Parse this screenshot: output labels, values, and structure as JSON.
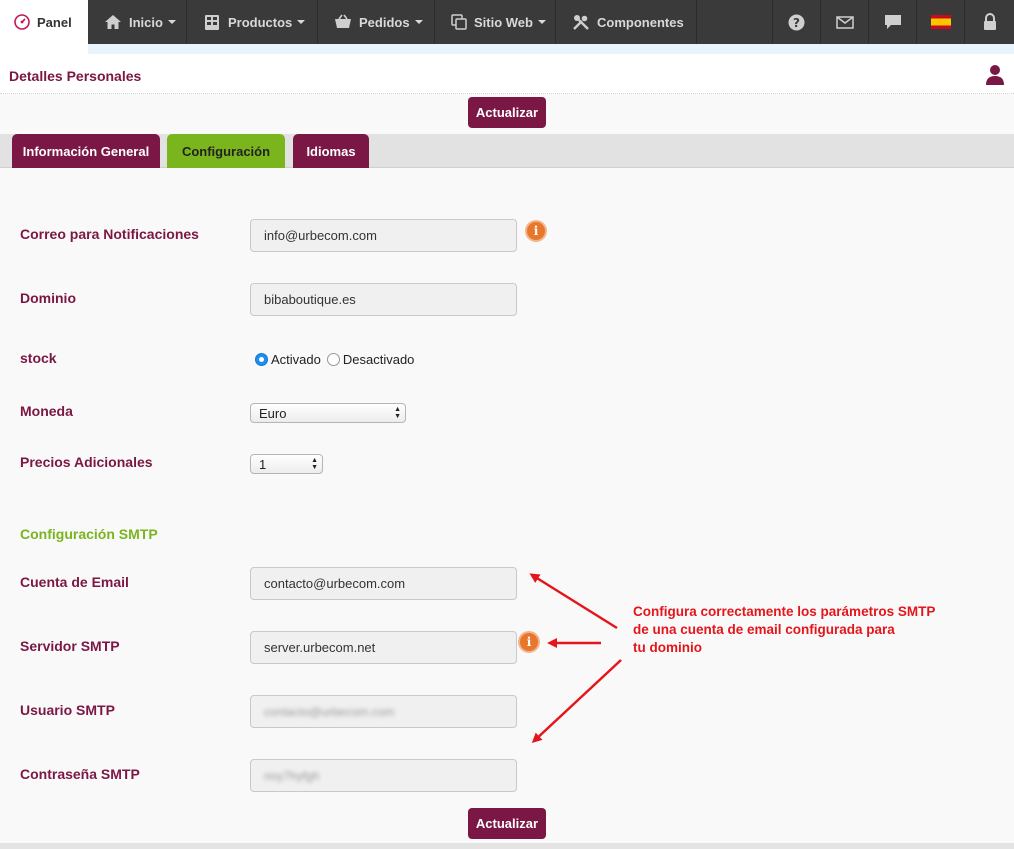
{
  "nav": {
    "panel": "Panel",
    "items": [
      {
        "label": "Inicio",
        "dropdown": true
      },
      {
        "label": "Productos",
        "dropdown": true
      },
      {
        "label": "Pedidos",
        "dropdown": true
      },
      {
        "label": "Sitio Web",
        "dropdown": true
      },
      {
        "label": "Componentes",
        "dropdown": false
      }
    ],
    "right_icons": [
      "help-icon",
      "mail-icon",
      "chat-icon",
      "spain-flag-icon",
      "lock-icon"
    ]
  },
  "header": {
    "title": "Detalles Personales"
  },
  "buttons": {
    "update_top": "Actualizar",
    "update_bottom": "Actualizar"
  },
  "tabs": [
    {
      "label": "Información General",
      "active": false
    },
    {
      "label": "Configuración",
      "active": true
    },
    {
      "label": "Idiomas",
      "active": false
    }
  ],
  "form": {
    "email_notifications": {
      "label": "Correo para Notificaciones",
      "value": "info@urbecom.com"
    },
    "domain": {
      "label": "Dominio",
      "value": "bibaboutique.es"
    },
    "stock": {
      "label": "stock",
      "options": [
        "Activado",
        "Desactivado"
      ],
      "selected": "Activado"
    },
    "currency": {
      "label": "Moneda",
      "value": "Euro"
    },
    "extra_prices": {
      "label": "Precios Adicionales",
      "value": "1"
    }
  },
  "smtp": {
    "section_title": "Configuración SMTP",
    "email_account": {
      "label": "Cuenta de Email",
      "value": "contacto@urbecom.com"
    },
    "server": {
      "label": "Servidor SMTP",
      "value": "server.urbecom.net"
    },
    "user": {
      "label": "Usuario SMTP",
      "value": "contacto@urbecom.com"
    },
    "password": {
      "label": "Contraseña SMTP",
      "value": "noy7hyfgh"
    }
  },
  "annotation": {
    "lines": [
      "Configura correctamente los parámetros SMTP",
      "de una cuenta de email configurada para",
      "tu dominio"
    ],
    "color": "#e4151b"
  },
  "colors": {
    "brand": "#7a1744",
    "accent_green": "#7ab51d",
    "info_orange": "#e8772e"
  }
}
